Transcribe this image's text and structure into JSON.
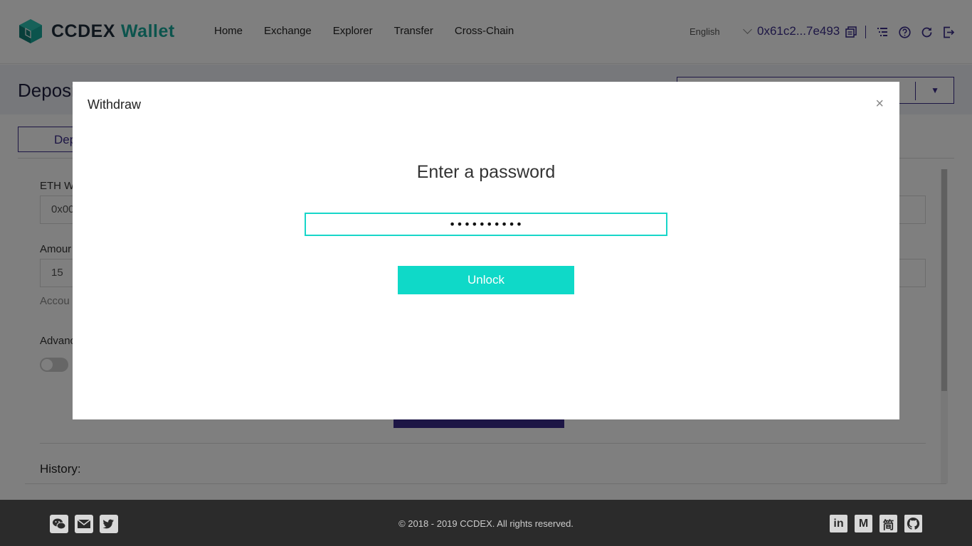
{
  "header": {
    "logo_main": "CCDEX",
    "logo_sub": "Wallet",
    "nav": [
      "Home",
      "Exchange",
      "Explorer",
      "Transfer",
      "Cross-Chain"
    ],
    "language": "English",
    "address": "0x61c2...7e493",
    "icons": [
      "copy-icon",
      "list-icon",
      "help-icon",
      "refresh-icon",
      "logout-icon"
    ]
  },
  "page": {
    "title": "Deposi",
    "tab_label": "Dep",
    "eth_label": "ETH W",
    "eth_value": "0x00",
    "amount_label": "Amour",
    "amount_value": "15",
    "account_hint": "Accou",
    "advanced_label": "Advanc",
    "history_label": "History:"
  },
  "modal": {
    "title": "Withdraw",
    "close": "×",
    "heading": "Enter a password",
    "password_value": "••••••••••",
    "unlock_label": "Unlock"
  },
  "footer": {
    "copyright": "© 2018 - 2019 CCDEX. All rights reserved.",
    "left_icons": [
      "wechat-icon",
      "mail-icon",
      "twitter-icon"
    ],
    "right_icons": [
      {
        "name": "linkedin-icon",
        "glyph": "in"
      },
      {
        "name": "medium-icon",
        "glyph": "M"
      },
      {
        "name": "jianshu-icon",
        "glyph": "简"
      },
      {
        "name": "github-icon",
        "glyph": ""
      }
    ]
  },
  "colors": {
    "brand": "#18a89b",
    "accent": "#3a2d8a",
    "unlock": "#0fd9c8"
  }
}
